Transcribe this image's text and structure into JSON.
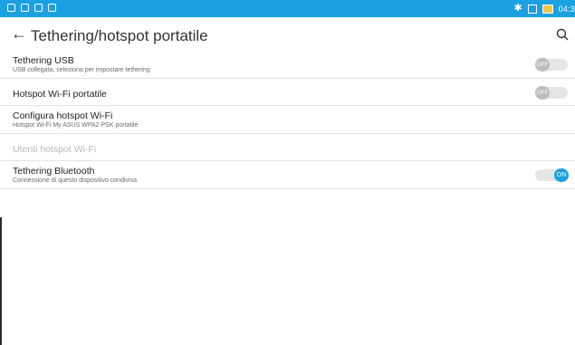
{
  "statusbar": {
    "time": "04:3"
  },
  "appbar": {
    "title": "Tethering/hotspot portatile"
  },
  "list": [
    {
      "title": "Tethering USB",
      "subtitle": "USB collegata, seleziona per impostare tethering",
      "toggle": "OFF"
    },
    {
      "title": "Hotspot Wi-Fi portatile",
      "toggle": "OFF"
    },
    {
      "title": "Configura hotspot Wi-Fi",
      "subtitle": "Hotspot Wi-Fi My ASUS WPA2 PSK portatile"
    },
    {
      "title": "Utenti hotspot Wi-Fi"
    },
    {
      "title": "Tethering Bluetooth",
      "subtitle": "Connessione di questo dispositivo condivisa",
      "toggle": "ON"
    }
  ]
}
